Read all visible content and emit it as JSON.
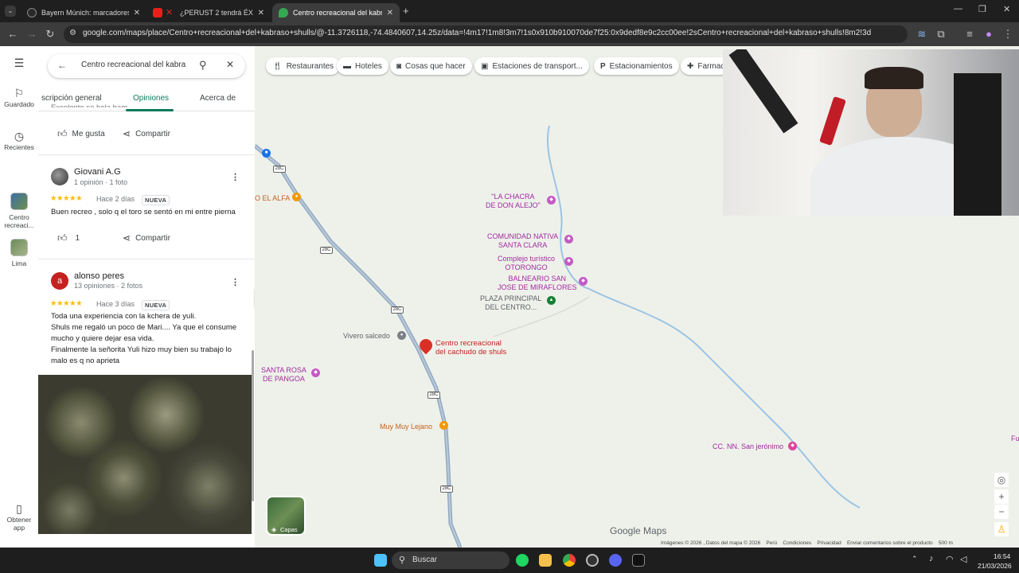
{
  "browser": {
    "tabs": [
      {
        "title": "Bayern Múnich: marcadores en",
        "active": false
      },
      {
        "title": "¿PERUST 2 tendrá ÉXITO? 😮",
        "active": false
      },
      {
        "title": "Centro recreacional del kabraso",
        "active": true
      }
    ],
    "url": "google.com/maps/place/Centro+recreacional+del+kabraso+shulls/@-11.3726118,-74.4840607,14.25z/data=!4m17!1m8!3m7!1s0x910b910070de7f25:0x9dedf8e9c2cc00ee!2sCentro+recreacional+del+kabraso+shulls!8m2!3d-11.3807082!..."
  },
  "rail": {
    "saved": "Guardado",
    "recent": "Recientes",
    "place": "Centro recreaci...",
    "lima": "Lima",
    "get_app": "Obtener app"
  },
  "panel": {
    "search_value": "Centro recreacional del kabra",
    "tabs": [
      "scripción general",
      "Opiniones",
      "Acerca de"
    ],
    "snippet": "Excelente se hela bam",
    "like_label": "Me gusta",
    "share_label": "Compartir",
    "reviews": [
      {
        "name": "Giovani A.G",
        "meta": "1 opinión · 1 foto",
        "stars": "★★★★★",
        "when": "Hace 2 días",
        "badge": "NUEVA",
        "text": [
          "Buen recreo , solo q el toro se sentó en mi entre pierna"
        ],
        "likes": "1",
        "share": "Compartir"
      },
      {
        "name": "alonso peres",
        "initial": "a",
        "meta": "13 opiniones · 2 fotos",
        "stars": "★★★★★",
        "when": "Hace 3 días",
        "badge": "NUEVA",
        "text": [
          "Toda una experiencia con la kchera de yuli.",
          "Shuls me regaló un poco de Mari.... Ya que el consume",
          "mucho y quiere dejar esa vida.",
          "Finalmente la señorita Yuli hizo muy bien su trabajo lo",
          "malo es q no aprieta"
        ]
      }
    ]
  },
  "map": {
    "chips": [
      "Restaurantes",
      "Hoteles",
      "Cosas que hacer",
      "Estaciones de transport...",
      "Estacionamientos",
      "Farmac"
    ],
    "pois": {
      "chacra": "\"LA CHACRA\nDE DON ALEJO\"",
      "comunidad": "COMUNIDAD NATIVA\nSANTA CLARA",
      "complejo": "Complejo turístico\nOTORONGO",
      "balneario": "BALNEARIO SAN\nJOSE DE MIRAFLORES",
      "plaza": "PLAZA PRINCIPAL\nDEL CENTRO...",
      "vivero": "Vivero salcedo",
      "centro": "Centro recreacional\ndel cachudo de shuls",
      "santa_rosa": "SANTA ROSA\nDE PANGOA",
      "muy_lejano": "Muy Muy Lejano",
      "san_jeronimo": "CC. NN. San jerónimo",
      "alfa": "O EL ALFA",
      "fu": "Fu"
    },
    "road_shield": "28C",
    "layers": "Capas",
    "logo": "Google Maps",
    "attribution": "Imágenes © 2026 , Datos del mapa © 2026    Perú    Condiciones    Privacidad    Enviar comentarios sobre el producto    500 m"
  },
  "taskbar": {
    "search": "Buscar",
    "time": "16:54",
    "date": "21/03/2026"
  }
}
